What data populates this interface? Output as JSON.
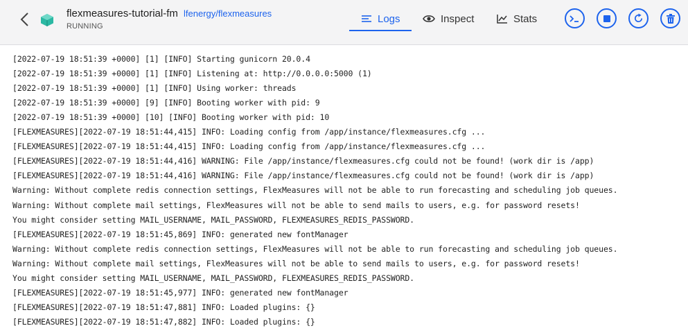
{
  "header": {
    "container_name": "flexmeasures-tutorial-fm",
    "image_link": "lfenergy/flexmeasures",
    "status": "RUNNING",
    "tabs": [
      {
        "label": "Logs",
        "icon": "lines-icon",
        "active": true
      },
      {
        "label": "Inspect",
        "icon": "eye-icon",
        "active": false
      },
      {
        "label": "Stats",
        "icon": "chart-icon",
        "active": false
      }
    ],
    "actions": [
      "terminal-icon",
      "stop-icon",
      "restart-icon",
      "delete-icon"
    ]
  },
  "colors": {
    "accent": "#1d63ed",
    "background": "#f4f4f5",
    "log_background": "#ffffff"
  },
  "logs": [
    "[2022-07-19 18:51:39 +0000] [1] [INFO] Starting gunicorn 20.0.4",
    "[2022-07-19 18:51:39 +0000] [1] [INFO] Listening at: http://0.0.0.0:5000 (1)",
    "[2022-07-19 18:51:39 +0000] [1] [INFO] Using worker: threads",
    "[2022-07-19 18:51:39 +0000] [9] [INFO] Booting worker with pid: 9",
    "[2022-07-19 18:51:39 +0000] [10] [INFO] Booting worker with pid: 10",
    "[FLEXMEASURES][2022-07-19 18:51:44,415] INFO: Loading config from /app/instance/flexmeasures.cfg ...",
    "[FLEXMEASURES][2022-07-19 18:51:44,415] INFO: Loading config from /app/instance/flexmeasures.cfg ...",
    "[FLEXMEASURES][2022-07-19 18:51:44,416] WARNING: File /app/instance/flexmeasures.cfg could not be found! (work dir is /app)",
    "[FLEXMEASURES][2022-07-19 18:51:44,416] WARNING: File /app/instance/flexmeasures.cfg could not be found! (work dir is /app)",
    "Warning: Without complete redis connection settings, FlexMeasures will not be able to run forecasting and scheduling job queues.",
    "Warning: Without complete mail settings, FlexMeasures will not be able to send mails to users, e.g. for password resets!",
    "You might consider setting MAIL_USERNAME, MAIL_PASSWORD, FLEXMEASURES_REDIS_PASSWORD.",
    "[FLEXMEASURES][2022-07-19 18:51:45,869] INFO: generated new fontManager",
    "Warning: Without complete redis connection settings, FlexMeasures will not be able to run forecasting and scheduling job queues.",
    "Warning: Without complete mail settings, FlexMeasures will not be able to send mails to users, e.g. for password resets!",
    "You might consider setting MAIL_USERNAME, MAIL_PASSWORD, FLEXMEASURES_REDIS_PASSWORD.",
    "[FLEXMEASURES][2022-07-19 18:51:45,977] INFO: generated new fontManager",
    "[FLEXMEASURES][2022-07-19 18:51:47,881] INFO: Loaded plugins: {}",
    "[FLEXMEASURES][2022-07-19 18:51:47,882] INFO: Loaded plugins: {}"
  ]
}
